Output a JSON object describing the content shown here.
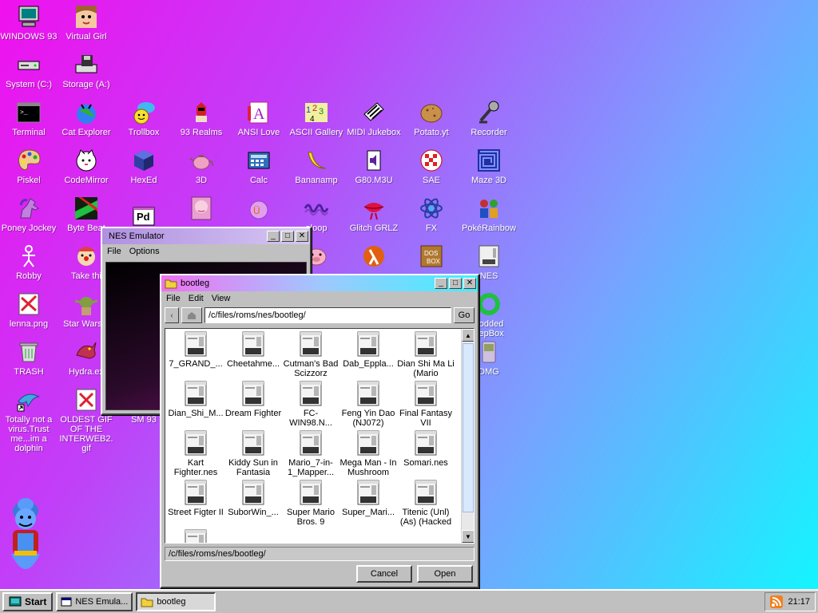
{
  "desktop_icons": [
    {
      "label": "WINDOWS 93",
      "icon": "computer-icon"
    },
    {
      "label": "Virtual Girl",
      "icon": "face-icon"
    },
    {
      "label": "System (C:)",
      "icon": "drive-icon"
    },
    {
      "label": "Storage (A:)",
      "icon": "floppy-drive-icon"
    },
    {
      "label": "Terminal",
      "icon": "terminal-icon"
    },
    {
      "label": "Cat Explorer",
      "icon": "globe-cat-icon"
    },
    {
      "label": "Trollbox",
      "icon": "chat-smiley-icon"
    },
    {
      "label": "93 Realms",
      "icon": "knight-icon"
    },
    {
      "label": "ANSI Love",
      "icon": "letter-a-icon"
    },
    {
      "label": "ASCII Gallery",
      "icon": "numbers-icon"
    },
    {
      "label": "MIDI Jukebox",
      "icon": "piano-icon"
    },
    {
      "label": "Potato.yt",
      "icon": "potato-icon"
    },
    {
      "label": "Recorder",
      "icon": "microphone-icon"
    },
    {
      "label": "Piskel",
      "icon": "palette-icon"
    },
    {
      "label": "CodeMirror",
      "icon": "cat-icon"
    },
    {
      "label": "HexEd",
      "icon": "cube-icon"
    },
    {
      "label": "3D",
      "icon": "teapot-icon"
    },
    {
      "label": "Calc",
      "icon": "calculator-icon"
    },
    {
      "label": "Bananamp",
      "icon": "banana-icon"
    },
    {
      "label": "G80.M3U",
      "icon": "speaker-icon"
    },
    {
      "label": "SAE",
      "icon": "checker-ball-icon"
    },
    {
      "label": "Maze 3D",
      "icon": "maze-icon"
    },
    {
      "label": "Poney Jockey",
      "icon": "pony-icon"
    },
    {
      "label": "Byte Beat",
      "icon": "glitch-icon"
    },
    {
      "label": "Pd",
      "icon": "pd-icon"
    },
    {
      "label": "",
      "icon": "face-book-icon"
    },
    {
      "label": "",
      "icon": "globe-ribbon-icon"
    },
    {
      "label": "oloop",
      "icon": "wave-icon"
    },
    {
      "label": "Glitch GRLZ",
      "icon": "lips-icon"
    },
    {
      "label": "FX",
      "icon": "atom-icon"
    },
    {
      "label": "PokéRainbow",
      "icon": "people-icon"
    },
    {
      "label": "Robby",
      "icon": "stickman-icon"
    },
    {
      "label": "Take thi",
      "icon": "clown-icon"
    },
    {
      "label": "",
      "icon": "pig-icon"
    },
    {
      "label": "",
      "icon": "lambda-icon"
    },
    {
      "label": "",
      "icon": "dos-box-icon"
    },
    {
      "label": "NES",
      "icon": "nes-icon"
    },
    {
      "label": "lenna.png",
      "icon": "image-icon"
    },
    {
      "label": "Star Wars.a",
      "icon": "yoda-icon"
    },
    {
      "label": "nodded eepBox",
      "icon": "ring-icon"
    },
    {
      "label": "TRASH",
      "icon": "trash-icon"
    },
    {
      "label": "Hydra.ex",
      "icon": "dragon-icon"
    },
    {
      "label": "DMG",
      "icon": "gameboy-icon"
    },
    {
      "label": "Totally not a virus.Trust me...im a dolphin",
      "icon": "dolphin-icon"
    },
    {
      "label": "OLDEST GIF OF THE INTERWEB2.gif",
      "icon": "gif-icon"
    },
    {
      "label": "SM 93",
      "icon": "blank-icon"
    }
  ],
  "nes_window": {
    "title": "NES Emulator",
    "menu": [
      "File",
      "Options"
    ]
  },
  "bootleg_window": {
    "title": "bootleg",
    "menu": [
      "File",
      "Edit",
      "View"
    ],
    "address": "/c/files/roms/nes/bootleg/",
    "go_label": "Go",
    "status": "/c/files/roms/nes/bootleg/",
    "cancel_label": "Cancel",
    "open_label": "Open",
    "files": [
      "7_GRAND_...",
      "Cheetahme...",
      "Cutman's Bad Scizzorz",
      "Dab_Eppla...",
      "Dian Shi Ma Li (Mario",
      "Dian_Shi_M...",
      "Dream Fighter",
      "FC-WIN98.N...",
      "Feng Yin Dao (NJ072)",
      "Final Fantasy VII",
      "Kart Fighter.nes",
      "Kiddy Sun in Fantasia",
      "Mario_7-in-1_Mapper...",
      "Mega Man - In Mushroom",
      "Somari.nes",
      "Street Figter II",
      "SuborWin_...",
      "Super Mario Bros. 9",
      "Super_Mari...",
      "Titenic (Unl) (As) (Hacked",
      ""
    ]
  },
  "taskbar": {
    "start_label": "Start",
    "items": [
      "NES Emula...",
      "bootleg"
    ],
    "clock": "21:17"
  },
  "colors": {
    "desktop_gradient": [
      "#f010ee",
      "#7aa0ff",
      "#10f8ff"
    ],
    "window_face": "#c0c0c0"
  }
}
